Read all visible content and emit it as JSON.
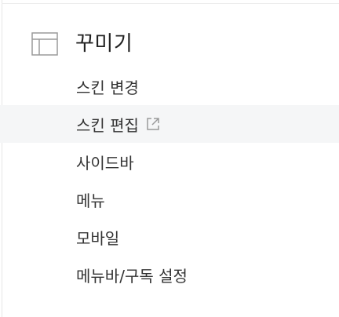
{
  "section": {
    "title": "꾸미기",
    "icon": "layout-icon"
  },
  "menu": {
    "items": [
      {
        "label": "스킨 변경"
      },
      {
        "label": "스킨 편집",
        "icon": "external-link-icon",
        "highlighted": true
      },
      {
        "label": "사이드바"
      },
      {
        "label": "메뉴"
      },
      {
        "label": "모바일"
      },
      {
        "label": "메뉴바/구독 설정"
      }
    ]
  },
  "colors": {
    "text": "#333333",
    "title": "#222222",
    "highlight_bg": "#f5f6f7",
    "icon_stroke": "#9a9a9a"
  }
}
